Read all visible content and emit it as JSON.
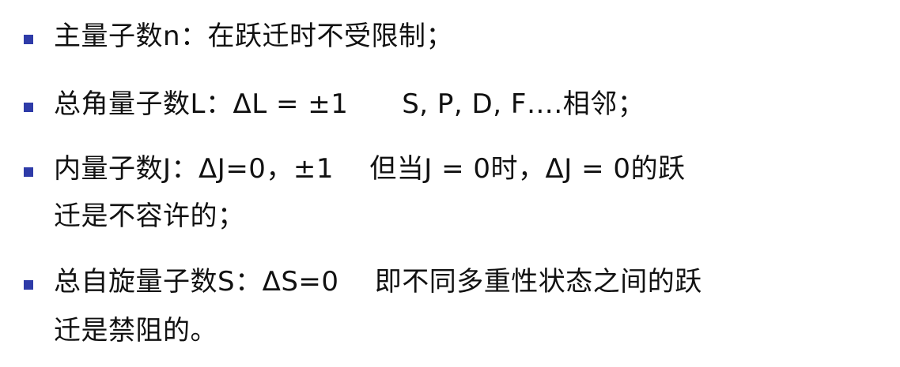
{
  "bullet_color": "#2e3ba8",
  "items": [
    {
      "line1": "主量子数n：在跃迁时不受限制；"
    },
    {
      "line1": "总角量子数L：ΔL = ±1      S, P, D, F….相邻；"
    },
    {
      "line1": "内量子数J：ΔJ=0，±1    但当J = 0时，ΔJ = 0的跃",
      "line2": "迁是不容许的；"
    },
    {
      "line1": "总自旋量子数S：ΔS=0    即不同多重性状态之间的跃",
      "line2": "迁是禁阻的。"
    }
  ]
}
